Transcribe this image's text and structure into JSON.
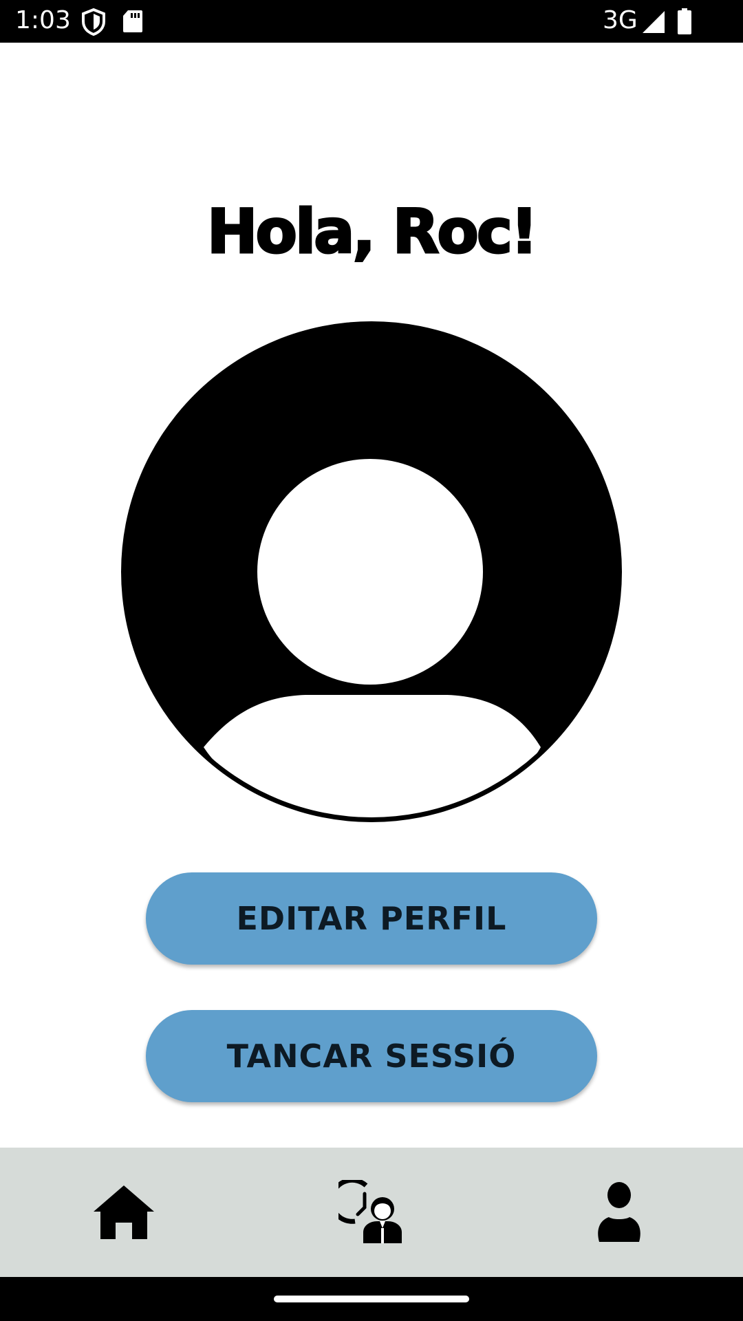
{
  "status_bar": {
    "time": "1:03",
    "network": "3G",
    "icons": [
      "shield-icon",
      "sd-card-icon",
      "signal-icon",
      "battery-icon"
    ]
  },
  "main": {
    "greeting": "Hola, Roc!",
    "avatar_icon": "user-avatar-icon"
  },
  "buttons": {
    "edit_profile": "EDITAR PERFIL",
    "logout": "TANCAR SESSIÓ"
  },
  "bottom_nav": {
    "items": [
      {
        "icon": "home-icon"
      },
      {
        "icon": "history-user-icon"
      },
      {
        "icon": "profile-icon"
      }
    ]
  },
  "colors": {
    "button_bg": "#5f9fcc",
    "button_text": "#0d1a24",
    "nav_bg": "#d6dbd8",
    "background": "#ffffff"
  }
}
